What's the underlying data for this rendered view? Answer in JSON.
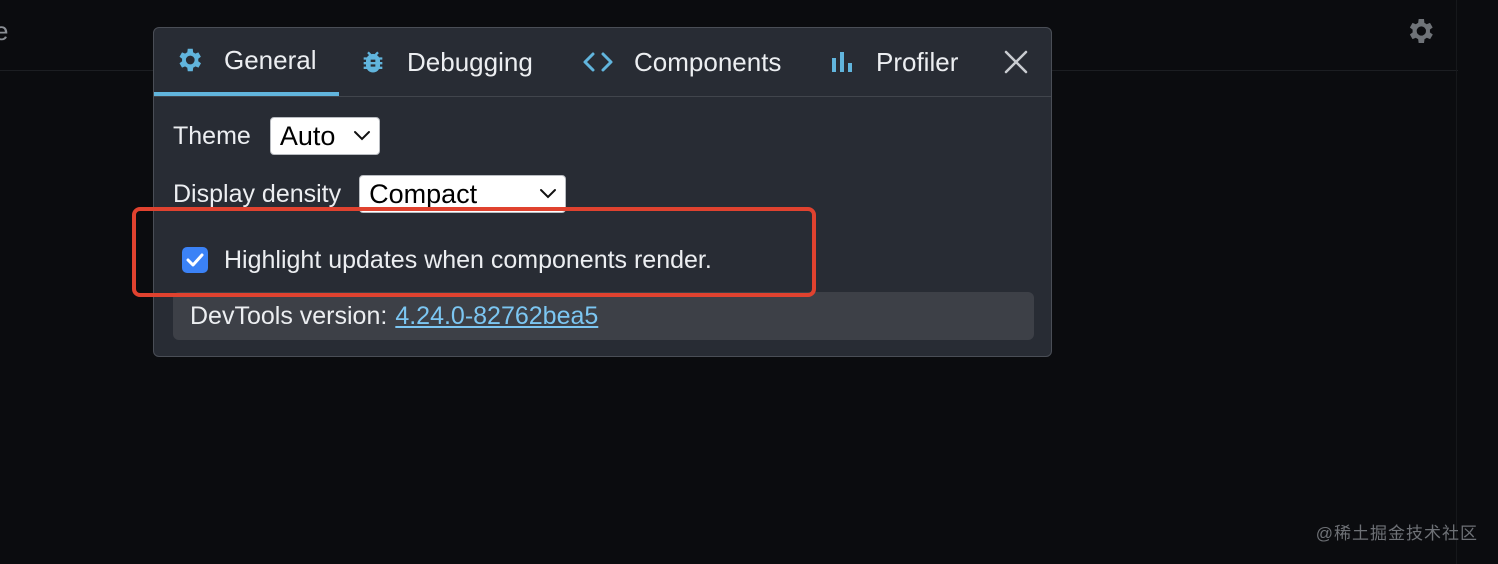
{
  "background": {
    "cut_text": "e",
    "watermark": "@稀土掘金技术社区"
  },
  "tabs": [
    {
      "label": "General",
      "icon": "gear-icon",
      "active": true
    },
    {
      "label": "Debugging",
      "icon": "bug-icon",
      "active": false
    },
    {
      "label": "Components",
      "icon": "code-brackets-icon",
      "active": false
    },
    {
      "label": "Profiler",
      "icon": "bar-chart-icon",
      "active": false
    }
  ],
  "settings": {
    "theme_label": "Theme",
    "theme_value": "Auto",
    "density_label": "Display density",
    "density_value": "Compact",
    "highlight_label": "Highlight updates when components render.",
    "highlight_checked": true,
    "version_label": "DevTools version:",
    "version_value": "4.24.0-82762bea5"
  },
  "colors": {
    "accent": "#61b5dd",
    "checkbox": "#3b82f6",
    "annotation": "#e0422f",
    "link": "#7cc6f2"
  }
}
